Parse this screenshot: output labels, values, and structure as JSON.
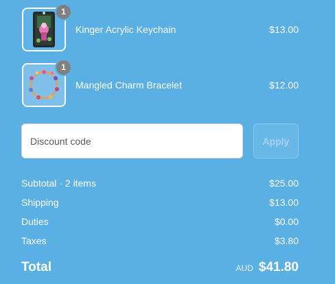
{
  "cart": {
    "items": [
      {
        "name": "Kinger Acrylic Keychain",
        "price": "$13.00",
        "quantity": "1",
        "thumbnail_icon": "keychain-image"
      },
      {
        "name": "Mangled Charm Bracelet",
        "price": "$12.00",
        "quantity": "1",
        "thumbnail_icon": "bracelet-image"
      }
    ]
  },
  "discount": {
    "placeholder": "Discount code",
    "value": "",
    "apply_label": "Apply"
  },
  "summary": {
    "subtotal_label": "Subtotal · 2 items",
    "subtotal_value": "$25.00",
    "shipping_label": "Shipping",
    "shipping_value": "$13.00",
    "duties_label": "Duties",
    "duties_value": "$0.00",
    "taxes_label": "Taxes",
    "taxes_value": "$3.80"
  },
  "total": {
    "label": "Total",
    "currency": "AUD",
    "amount": "$41.80"
  },
  "colors": {
    "background": "#5aafe3",
    "badge": "#808080",
    "text": "#ffffff",
    "apply_disabled_text": "#a7d3f1"
  }
}
